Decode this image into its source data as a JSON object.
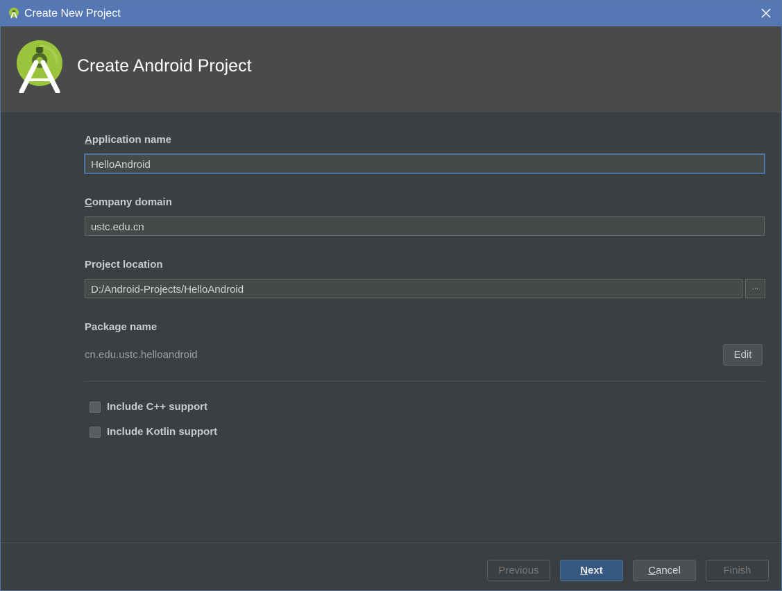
{
  "window": {
    "title": "Create New Project"
  },
  "header": {
    "title": "Create Android Project"
  },
  "form": {
    "app_name": {
      "label_first": "A",
      "label_rest": "pplication name",
      "value": "HelloAndroid"
    },
    "company_domain": {
      "label_first": "C",
      "label_rest": "ompany domain",
      "value": "ustc.edu.cn"
    },
    "project_location": {
      "label": "Project location",
      "value": "D:/Android-Projects/HelloAndroid",
      "browse_label": "..."
    },
    "package_name": {
      "label": "Package name",
      "value": "cn.edu.ustc.helloandroid",
      "edit_label": "Edit"
    },
    "cpp_support": {
      "label": "Include C++ support",
      "checked": false
    },
    "kotlin_support": {
      "label": "Include Kotlin support",
      "checked": false
    }
  },
  "footer": {
    "previous": "Previous",
    "next_first": "N",
    "next_rest": "ext",
    "cancel_first": "C",
    "cancel_rest": "ancel",
    "finish": "Finish"
  },
  "colors": {
    "titlebar": "#5577b4",
    "header": "#4a4a4a",
    "background": "#3c3f41",
    "accent": "#365880",
    "android_green": "#9ac43c"
  }
}
